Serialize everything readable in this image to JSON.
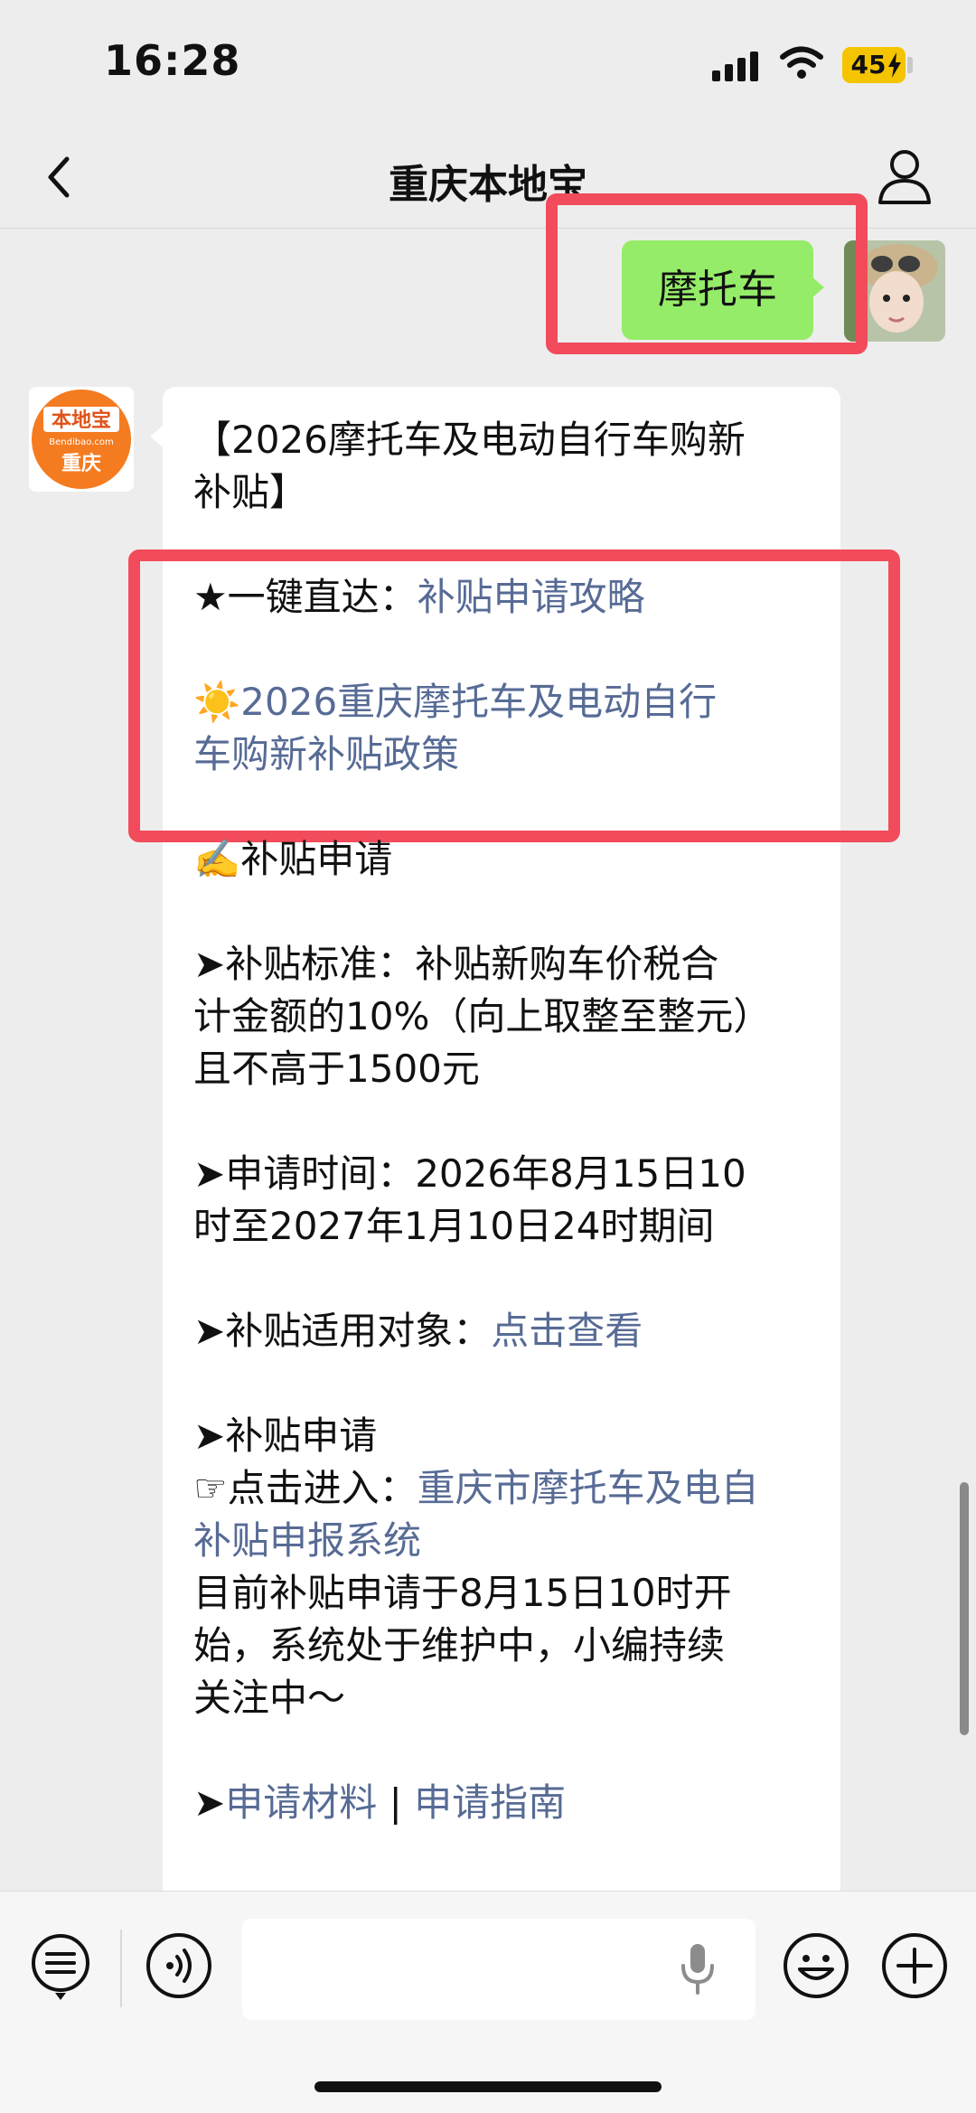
{
  "status_bar": {
    "time": "16:28",
    "battery": "45"
  },
  "nav": {
    "title": "重庆本地宝",
    "back_icon": "chevron-left-icon",
    "profile_icon": "person-icon"
  },
  "user_message": {
    "text": "摩托车"
  },
  "bot": {
    "avatar_logo": "本地宝",
    "avatar_domain": "Bendibao.com",
    "avatar_city": "重庆",
    "title_line1": "【2026摩托车及电动自行车购新",
    "title_line2": "补贴】",
    "quick_prefix": "★一键直达：",
    "quick_link": "补贴申请攻略",
    "policy_emoji": "☀️",
    "policy_link_line1": "2026重庆摩托车及电动自行",
    "policy_link_line2": "车购新补贴政策",
    "apply_header": "✍️补贴申请",
    "standard_line1": "➤补贴标准：补贴新购车价税合",
    "standard_line2": "计金额的10%（向上取整至整元）",
    "standard_line3": "且不高于1500元",
    "time_line1": "➤申请时间：2026年8月15日10",
    "time_line2": "时至2027年1月10日24时期间",
    "target_prefix": "➤补贴适用对象：",
    "target_link": "点击查看",
    "apply2_header": "➤补贴申请",
    "enter_prefix": "☞点击进入：",
    "enter_link_line1": "重庆市摩托车及电自",
    "enter_link_line2": "补贴申报系统",
    "notice_line1": "目前补贴申请于8月15日10时开",
    "notice_line2": "始，系统处于维护中，小编持续",
    "notice_line3": "关注中～",
    "materials_prefix": "➤",
    "materials_link": "申请材料",
    "separator": " | ",
    "guide_link": "申请指南"
  },
  "colors": {
    "user_bubble": "#95ec69",
    "link": "#576b95",
    "highlight": "#f24b5b",
    "battery": "#f5c400",
    "background": "#ededed"
  },
  "input_bar": {
    "menu_icon": "list-menu-icon",
    "voice_icon": "voice-icon",
    "mic_icon": "microphone-icon",
    "emoji_icon": "emoji-icon",
    "plus_icon": "plus-icon"
  }
}
